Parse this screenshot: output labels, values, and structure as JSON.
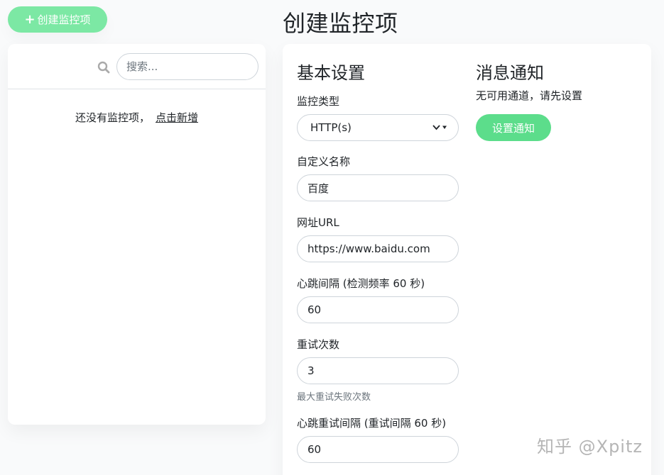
{
  "header": {
    "create_button_label": "创建监控项",
    "page_title": "创建监控项"
  },
  "monitor_list": {
    "search_placeholder": "搜索...",
    "empty_text": "还没有监控项，",
    "empty_link": "点击新增"
  },
  "basic_settings": {
    "title": "基本设置",
    "monitor_type": {
      "label": "监控类型",
      "value": "HTTP(s)"
    },
    "friendly_name": {
      "label": "自定义名称",
      "value": "百度"
    },
    "url": {
      "label": "网址URL",
      "value": "https://www.baidu.com"
    },
    "heartbeat_interval": {
      "label": "心跳间隔 (检测频率 60 秒)",
      "value": "60"
    },
    "retries": {
      "label": "重试次数",
      "value": "3",
      "helper": "最大重试失败次数"
    },
    "retry_interval": {
      "label": "心跳重试间隔 (重试间隔 60 秒)",
      "value": "60"
    }
  },
  "notifications": {
    "title": "消息通知",
    "empty_text": "无可用通道，请先设置",
    "setup_button_label": "设置通知"
  },
  "watermark": "知乎 @Xpitz",
  "colors": {
    "primary": "#5cdd8b",
    "primary_light": "#7ce8a4",
    "background": "#f9fafb"
  }
}
